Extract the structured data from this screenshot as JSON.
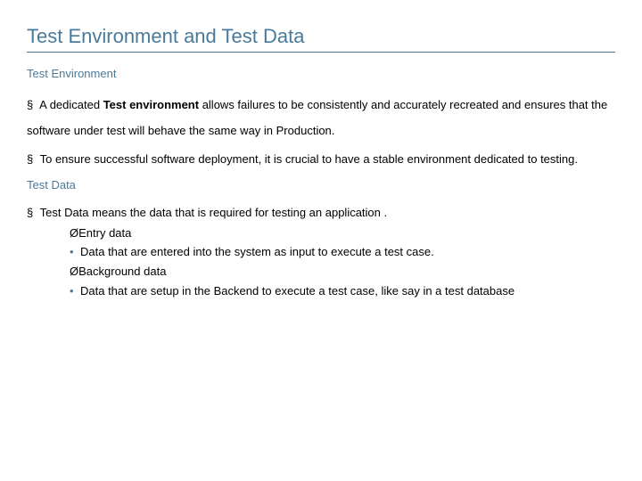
{
  "title": "Test Environment and Test Data",
  "section1": {
    "heading": "Test Environment",
    "p1_prefix": " A  dedicated ",
    "p1_bold": "Test environment",
    "p1_suffix": " allows failures to be consistently and accurately recreated and ensures that the software under test will behave the same way in Production.",
    "p2": " To ensure successful software deployment, it is crucial to have a stable environment dedicated to testing."
  },
  "section2": {
    "heading": "Test Data",
    "p1": " Test Data means the data that is required for testing an application .",
    "sub": {
      "a": "Entry data",
      "b": "Data that are entered into the system as input to execute a test case.",
      "c": "Background data",
      "d": "Data that are setup in the Backend to execute a test case, like say in a test database"
    }
  }
}
